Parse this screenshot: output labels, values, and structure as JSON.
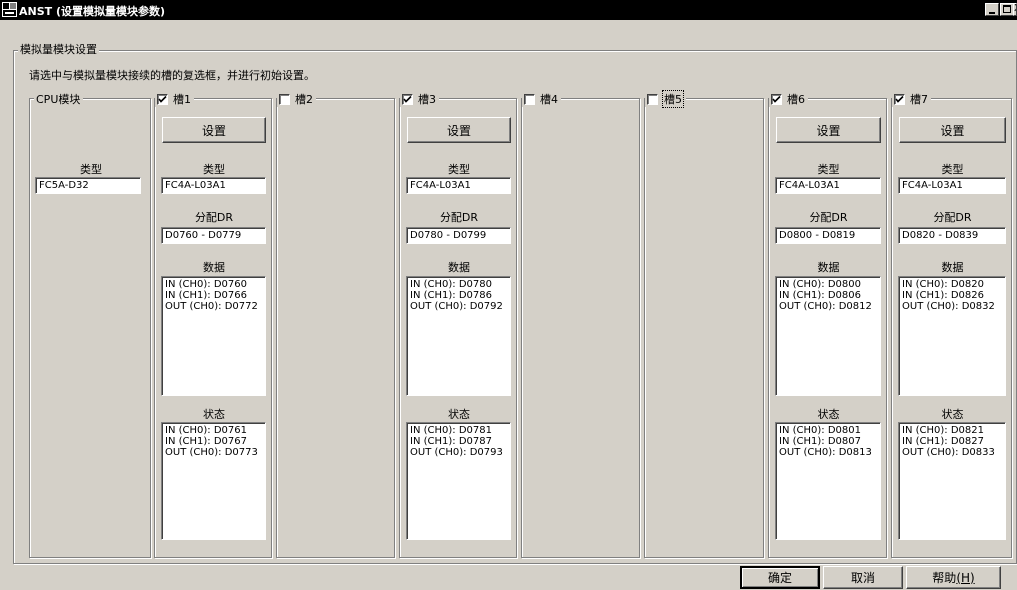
{
  "window": {
    "title": "ANST (设置模拟量模块参数)",
    "minimize_label": "_",
    "close_label": "X"
  },
  "group": {
    "title": "模拟量模块设置",
    "instruction": "请选中与模拟量模块接续的槽的复选框，并进行初始设置。"
  },
  "cpu": {
    "title": "CPU模块",
    "type_label": "类型",
    "type_value": "FC5A-D32"
  },
  "labels": {
    "setup": "设置",
    "type": "类型",
    "dr": "分配DR",
    "data": "数据",
    "status": "状态"
  },
  "slots": [
    {
      "name": "槽1",
      "checked": true,
      "type": "FC4A-L03A1",
      "dr": "D0760 - D0779",
      "data": [
        "IN (CH0): D0760",
        "IN (CH1): D0766",
        "OUT (CH0): D0772"
      ],
      "status": [
        "IN (CH0): D0761",
        "IN (CH1): D0767",
        "OUT (CH0): D0773"
      ]
    },
    {
      "name": "槽2",
      "checked": false
    },
    {
      "name": "槽3",
      "checked": true,
      "type": "FC4A-L03A1",
      "dr": "D0780 - D0799",
      "data": [
        "IN (CH0): D0780",
        "IN (CH1): D0786",
        "OUT (CH0): D0792"
      ],
      "status": [
        "IN (CH0): D0781",
        "IN (CH1): D0787",
        "OUT (CH0): D0793"
      ]
    },
    {
      "name": "槽4",
      "checked": false
    },
    {
      "name": "槽5",
      "checked": false,
      "focused": true
    },
    {
      "name": "槽6",
      "checked": true,
      "type": "FC4A-L03A1",
      "dr": "D0800 - D0819",
      "data": [
        "IN (CH0): D0800",
        "IN (CH1): D0806",
        "OUT (CH0): D0812"
      ],
      "status": [
        "IN (CH0): D0801",
        "IN (CH1): D0807",
        "OUT (CH0): D0813"
      ]
    },
    {
      "name": "槽7",
      "checked": true,
      "type": "FC4A-L03A1",
      "dr": "D0820 - D0839",
      "data": [
        "IN (CH0): D0820",
        "IN (CH1): D0826",
        "OUT (CH0): D0832"
      ],
      "status": [
        "IN (CH0): D0821",
        "IN (CH1): D0827",
        "OUT (CH0): D0833"
      ]
    }
  ],
  "buttons": {
    "ok": "确定",
    "cancel": "取消",
    "help": "帮助",
    "help_key": "(H)"
  }
}
